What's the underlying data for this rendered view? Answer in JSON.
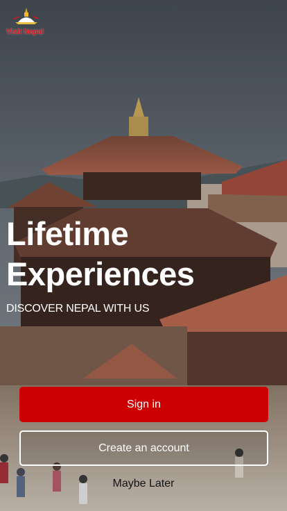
{
  "logo": {
    "text": "Visit Nepal",
    "icon": "stupa-logo-icon",
    "color": "#d6161c"
  },
  "hero": {
    "headline_line1": "Lifetime",
    "headline_line2": "Experiences",
    "subheadline": "DISCOVER NEPAL WITH US"
  },
  "actions": {
    "sign_in": "Sign in",
    "create_account": "Create an account",
    "maybe_later": "Maybe Later"
  },
  "colors": {
    "primary": "#cc0000",
    "text_light": "#ffffff",
    "text_dark": "#141414"
  },
  "background": {
    "image": "nepal-pagoda-temple-square-photo"
  }
}
